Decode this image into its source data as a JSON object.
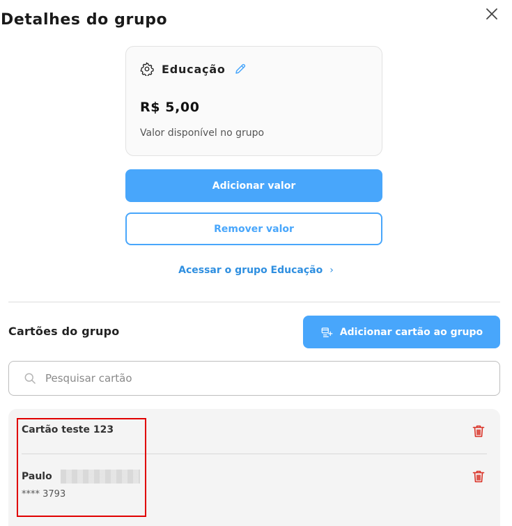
{
  "modal": {
    "title": "Detalhes do grupo",
    "close_icon": "close-icon"
  },
  "group_card": {
    "name": "Educação",
    "icon": "gear-icon",
    "edit_icon": "pencil-icon",
    "amount": "R$ 5,00",
    "subtitle": "Valor disponível no grupo"
  },
  "actions": {
    "add_value": "Adicionar valor",
    "remove_value": "Remover valor",
    "access_link": "Acessar o grupo Educação",
    "access_chevron": "›"
  },
  "cards_section": {
    "title": "Cartões do grupo",
    "add_card_button": "Adicionar cartão ao grupo",
    "add_card_icon": "card-add-icon",
    "search_placeholder": "Pesquisar cartão",
    "items": [
      {
        "name": "Cartão teste 123",
        "number": ""
      },
      {
        "name": "Paulo",
        "number": "**** 3793"
      }
    ]
  },
  "colors": {
    "primary": "#48a6fb",
    "link": "#2f8fe0",
    "delete": "#d93025",
    "highlight": "#e00000"
  }
}
